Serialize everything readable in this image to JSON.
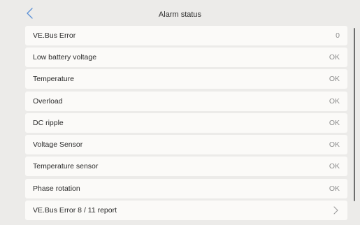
{
  "header": {
    "title": "Alarm status",
    "back_icon": "chevron-left-icon"
  },
  "colors": {
    "background": "#ecebe9",
    "row_background": "#fbfaf8",
    "accent": "#5a8fd6",
    "value_text": "#8c8c8c"
  },
  "rows": [
    {
      "label": "VE.Bus Error",
      "value": "0"
    },
    {
      "label": "Low battery voltage",
      "value": "OK"
    },
    {
      "label": "Temperature",
      "value": "OK"
    },
    {
      "label": "Overload",
      "value": "OK"
    },
    {
      "label": "DC ripple",
      "value": "OK"
    },
    {
      "label": "Voltage Sensor",
      "value": "OK"
    },
    {
      "label": "Temperature sensor",
      "value": "OK"
    },
    {
      "label": "Phase rotation",
      "value": "OK"
    },
    {
      "label": "VE.Bus Error 8 / 11 report",
      "value": "",
      "icon": "chevron-right-icon"
    }
  ]
}
